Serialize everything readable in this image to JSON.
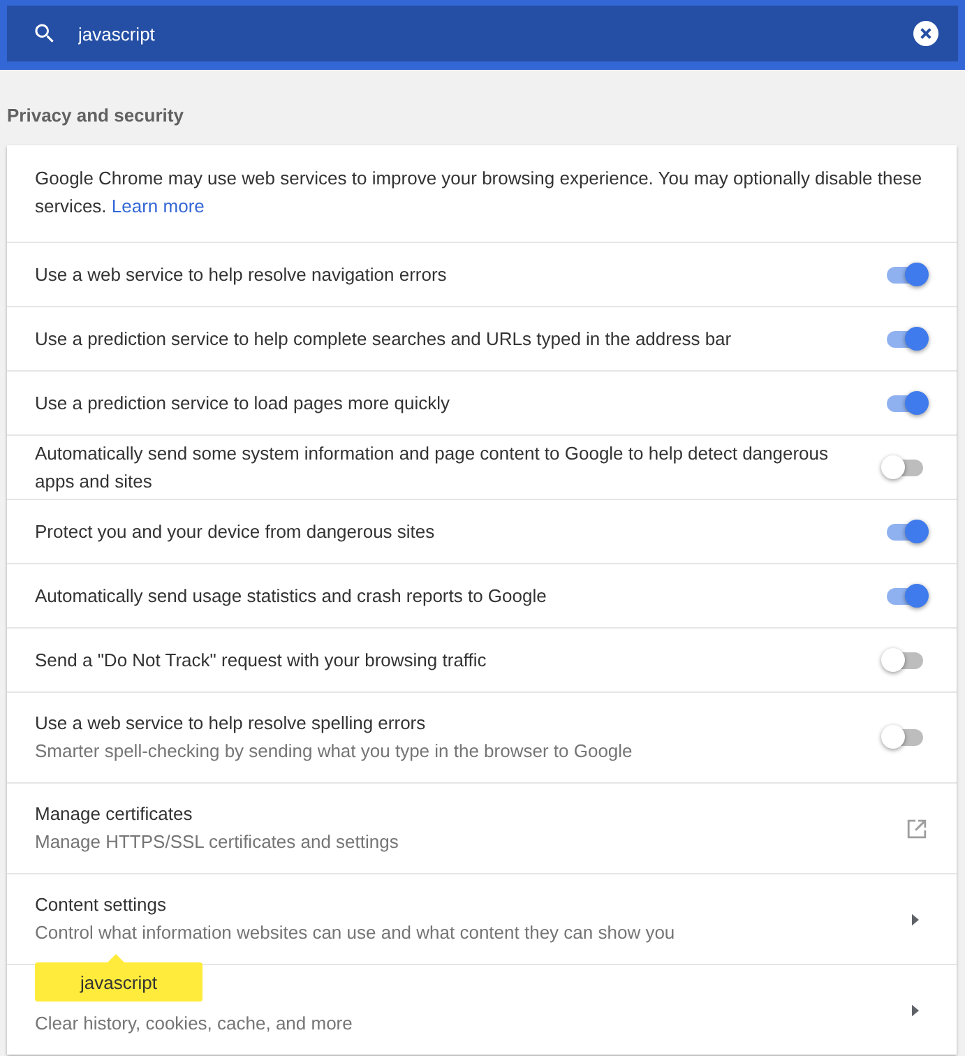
{
  "search": {
    "value": "javascript"
  },
  "section_title": "Privacy and security",
  "intro": {
    "text": "Google Chrome may use web services to improve your browsing experience. You may optionally disable these services.",
    "link": "Learn more"
  },
  "rows": [
    {
      "kind": "toggle",
      "title": "Use a web service to help resolve navigation errors",
      "on": true
    },
    {
      "kind": "toggle",
      "title": "Use a prediction service to help complete searches and URLs typed in the address bar",
      "on": true
    },
    {
      "kind": "toggle",
      "title": "Use a prediction service to load pages more quickly",
      "on": true
    },
    {
      "kind": "toggle",
      "title": "Automatically send some system information and page content to Google to help detect dangerous apps and sites",
      "on": false
    },
    {
      "kind": "toggle",
      "title": "Protect you and your device from dangerous sites",
      "on": true
    },
    {
      "kind": "toggle",
      "title": "Automatically send usage statistics and crash reports to Google",
      "on": true
    },
    {
      "kind": "toggle",
      "title": "Send a \"Do Not Track\" request with your browsing traffic",
      "on": false
    },
    {
      "kind": "toggle",
      "title": "Use a web service to help resolve spelling errors",
      "subtitle": "Smarter spell-checking by sending what you type in the browser to Google",
      "on": false
    },
    {
      "kind": "external",
      "title": "Manage certificates",
      "subtitle": "Manage HTTPS/SSL certificates and settings"
    },
    {
      "kind": "arrow",
      "title": "Content settings",
      "subtitle": "Control what information websites can use and what content they can show you"
    },
    {
      "kind": "arrow",
      "subtitle": "Clear history, cookies, cache, and more",
      "tooltip": "javascript"
    }
  ]
}
